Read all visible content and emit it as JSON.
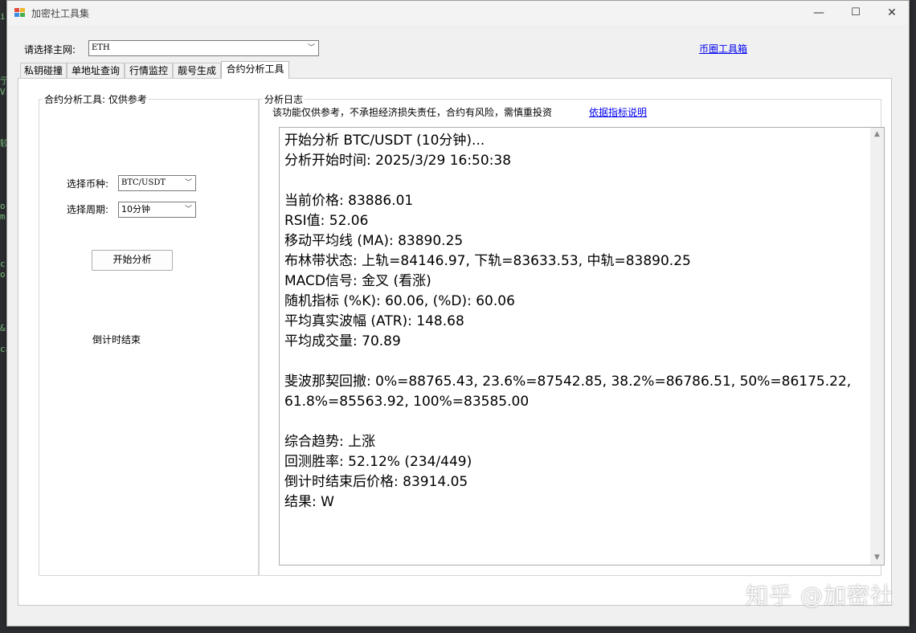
{
  "window": {
    "title": "加密社工具集",
    "minimize": "—",
    "maximize": "☐",
    "close": "✕"
  },
  "header": {
    "network_label": "请选择主网:",
    "network_value": "ETH",
    "toolbox_link": "币圈工具箱"
  },
  "tabs": [
    {
      "label": "私钥碰撞"
    },
    {
      "label": "单地址查询"
    },
    {
      "label": "行情监控"
    },
    {
      "label": "靓号生成"
    },
    {
      "label": "合约分析工具"
    }
  ],
  "left_panel": {
    "title": "合约分析工具: 仅供参考",
    "coin_label": "选择币种:",
    "coin_value": "BTC/USDT",
    "period_label": "选择周期:",
    "period_value": "10分钟",
    "start_button": "开始分析",
    "countdown_text": "倒计时结束"
  },
  "log_panel": {
    "title": "分析日志",
    "disclaimer": "该功能仅供参考，不承担经济损失责任，合约有风险，需慎重投资",
    "indicator_link": "依据指标说明",
    "lines": [
      "开始分析 BTC/USDT (10分钟)...",
      "分析开始时间: 2025/3/29 16:50:38",
      "",
      "当前价格: 83886.01",
      "RSI值: 52.06",
      "移动平均线 (MA): 83890.25",
      "布林带状态: 上轨=84146.97, 下轨=83633.53, 中轨=83890.25",
      "MACD信号: 金叉 (看涨)",
      "随机指标 (%K): 60.06, (%D): 60.06",
      "平均真实波幅 (ATR): 148.68",
      "平均成交量: 70.89",
      "",
      "斐波那契回撤: 0%=88765.43, 23.6%=87542.85, 38.2%=86786.51, 50%=86175.22, 61.8%=85563.92, 100%=83585.00",
      "",
      "综合趋势: 上涨",
      "回测胜率: 52.12% (234/449)",
      "倒计时结束后价格: 83914.05",
      "结果: W"
    ]
  },
  "watermark": "知乎 @加密社"
}
